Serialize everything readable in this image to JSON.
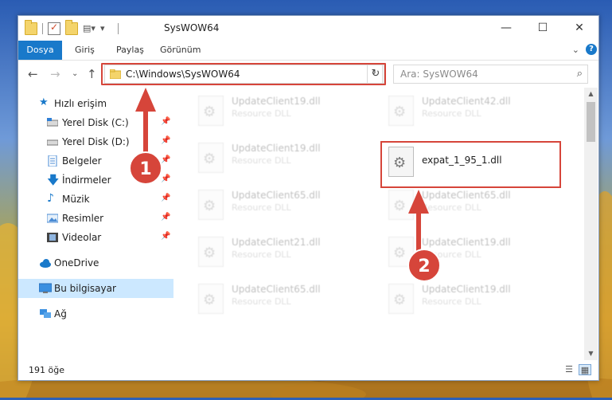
{
  "window": {
    "title": "SysWOW64",
    "minimize_glyph": "—",
    "maximize_glyph": "☐",
    "close_glyph": "✕"
  },
  "ribbon": {
    "tabs": [
      "Dosya",
      "Giriş",
      "Paylaş",
      "Görünüm"
    ],
    "expand_glyph": "⌄",
    "help_glyph": "?"
  },
  "address": {
    "path": "C:\\Windows\\SysWOW64",
    "dropdown_glyph": "⌄",
    "refresh_glyph": "↻",
    "back_glyph": "←",
    "forward_glyph": "→",
    "recent_glyph": "⌄",
    "up_glyph": "↑"
  },
  "search": {
    "placeholder": "Ara: SysWOW64",
    "icon_glyph": "⌕"
  },
  "nav": {
    "items": [
      {
        "label": "Hızlı erişim",
        "pinned": false
      },
      {
        "label": "Yerel Disk (C:)",
        "pinned": true
      },
      {
        "label": "Yerel Disk (D:)",
        "pinned": true
      },
      {
        "label": "Belgeler",
        "pinned": true
      },
      {
        "label": "İndirmeler",
        "pinned": true
      },
      {
        "label": "Müzik",
        "pinned": true
      },
      {
        "label": "Resimler",
        "pinned": true
      },
      {
        "label": "Videolar",
        "pinned": true
      },
      {
        "label": "OneDrive",
        "pinned": false
      },
      {
        "label": "Bu bilgisayar",
        "pinned": false
      },
      {
        "label": "Ağ",
        "pinned": false
      }
    ],
    "pin_glyph": "📌"
  },
  "files": {
    "left_column": [
      {
        "name": "UpdateClient19.dll",
        "type": "Resource DLL"
      },
      {
        "name": "UpdateClient19.dll",
        "type": "Resource DLL"
      },
      {
        "name": "UpdateClient65.dll",
        "type": "Resource DLL"
      },
      {
        "name": "UpdateClient21.dll",
        "type": "Resource DLL"
      },
      {
        "name": "UpdateClient65.dll",
        "type": "Resource DLL"
      }
    ],
    "right_column": [
      {
        "name": "UpdateClient42.dll",
        "type": "Resource DLL"
      },
      {
        "name": "expat_1_95_1.dll",
        "type": ""
      },
      {
        "name": "UpdateClient65.dll",
        "type": "Resource DLL"
      },
      {
        "name": "UpdateClient19.dll",
        "type": "Resource DLL"
      },
      {
        "name": "UpdateClient19.dll",
        "type": "Resource DLL"
      }
    ]
  },
  "status": {
    "count_text": "191 öğe"
  },
  "annotations": {
    "step1": "1",
    "step2": "2",
    "color": "#d6453a"
  }
}
